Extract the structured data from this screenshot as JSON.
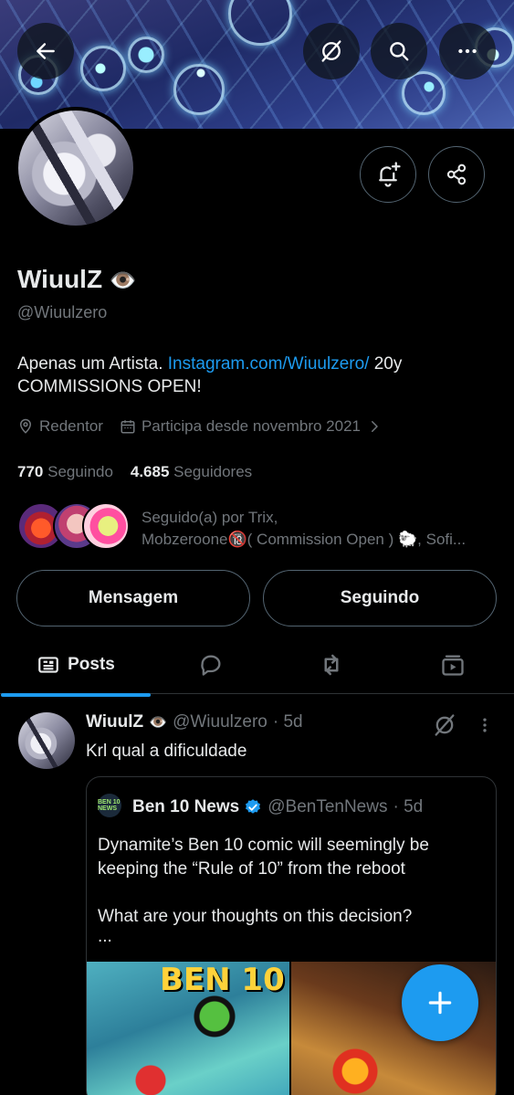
{
  "header": {
    "back_icon": "arrow-left-icon",
    "grok_icon": "grok-icon",
    "search_icon": "search-icon",
    "more_icon": "more-horizontal-icon"
  },
  "profile": {
    "name": "WiuulZ",
    "name_emoji": "👁️",
    "handle": "@Wiuulzero",
    "bio_text": "Apenas um Artista. ",
    "bio_link": "Instagram.com/Wiuulzero/",
    "bio_after": " 20y",
    "bio_line2": "COMMISSIONS OPEN!",
    "location": "Redentor",
    "joined": "Participa desde novembro 2021",
    "following_count": "770",
    "following_label": "Seguindo",
    "followers_count": "4.685",
    "followers_label": "Seguidores",
    "followed_by_line1": "Seguido(a) por Trix,",
    "followed_by_line2": "Mobzeroone🔞( Commission Open ) 🐑, Sofi..."
  },
  "actions": {
    "message_label": "Mensagem",
    "following_label": "Seguindo"
  },
  "tabs": {
    "posts_label": "Posts"
  },
  "tweet": {
    "name": "WiuulZ",
    "emoji": "👁️",
    "handle": "@Wiuulzero",
    "time": "· 5d",
    "text": "Krl qual a dificuldade",
    "quote": {
      "avatar_text": "BEN 10 NEWS",
      "name": "Ben 10 News",
      "handle": "@BenTenNews",
      "time": "· 5d",
      "text_line1": "Dynamite’s Ben 10 comic will seemingly be keeping the “Rule of 10” from the reboot",
      "text_line2": "What are your thoughts on this decision?",
      "text_more": "...",
      "image1_title": "BEN 10"
    }
  },
  "colors": {
    "accent": "#1d9bf0",
    "text_primary": "#e7e9ea",
    "text_secondary": "#71767b",
    "border": "#2f3336"
  }
}
